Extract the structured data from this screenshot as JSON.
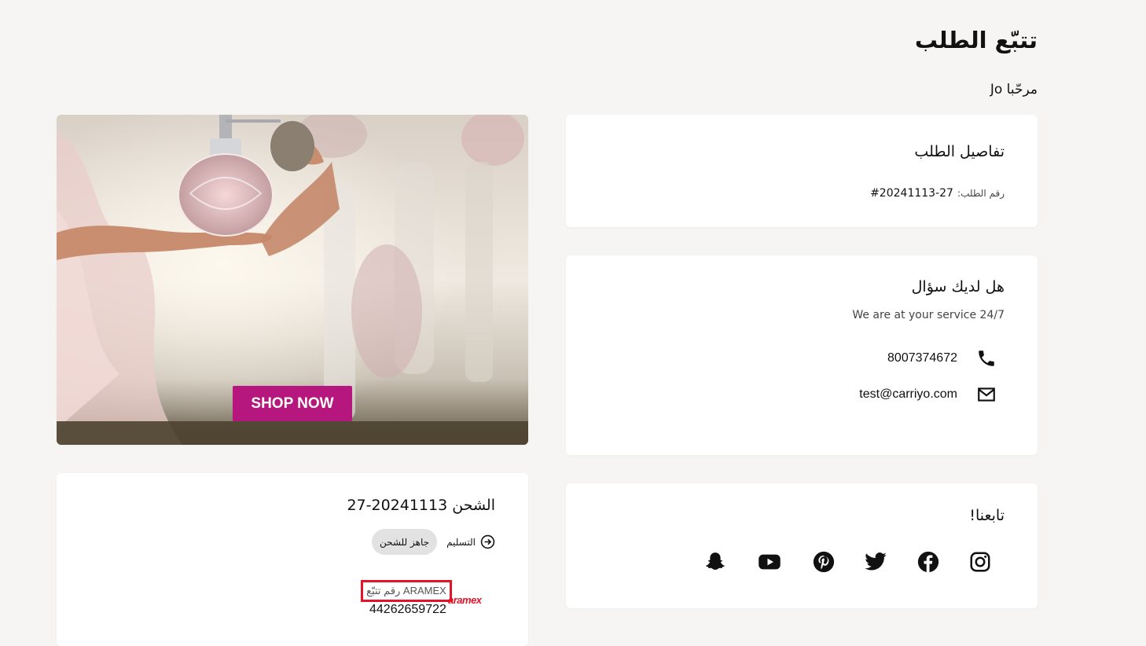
{
  "page": {
    "title": "تتبّع الطلب",
    "greeting": "مرحّبا Jo"
  },
  "order_details": {
    "title": "تفاصيل الطلب",
    "order_number_label": "رقم الطلب:",
    "order_number": "#20241113-27"
  },
  "support": {
    "title": "هل لديك سؤال",
    "subtitle": "We are at your service 24/7",
    "phone": "8007374672",
    "email": "test@carriyo.com",
    "phone_icon": "phone-icon",
    "email_icon": "mail-icon"
  },
  "follow": {
    "title": "تابعنا!",
    "icons": [
      "instagram-icon",
      "facebook-icon",
      "twitter-icon",
      "pinterest-icon",
      "youtube-icon",
      "snapchat-icon"
    ]
  },
  "hero": {
    "button_label": "SHOP NOW",
    "accent": "#b5177e"
  },
  "shipment": {
    "title": "الشحن 20241113-27",
    "delivery_label": "التسليم",
    "status": "جاهز للشحن",
    "tracking_label": "رقم تتبّع ARAMEX",
    "carrier_logo_text": "aramex",
    "tracking_number": "44262659722"
  }
}
